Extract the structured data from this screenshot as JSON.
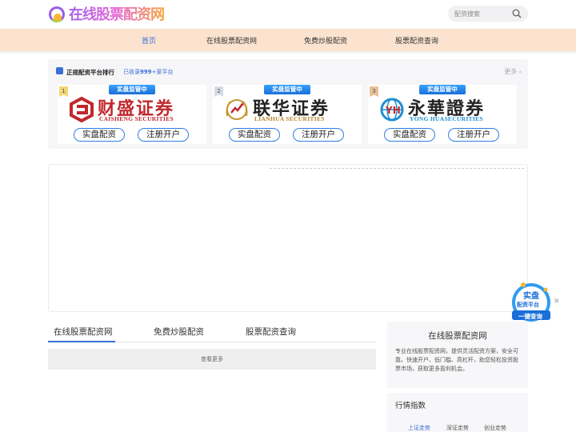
{
  "header": {
    "logo_text": "在线股票配资网",
    "search_placeholder": "配资搜索"
  },
  "nav": {
    "items": [
      {
        "label": "首页",
        "active": true
      },
      {
        "label": "在线股票配资网",
        "active": false
      },
      {
        "label": "免费炒股配资",
        "active": false
      },
      {
        "label": "股票配资查询",
        "active": false
      }
    ]
  },
  "ranking": {
    "title": "正规配资平台排行",
    "subtitle_prefix": "已收录",
    "subtitle_count": "999",
    "subtitle_suffix": "+家平台",
    "more": "更多",
    "cards": [
      {
        "rank": "1",
        "tag": "实盘监管中",
        "name": "财盛证券",
        "en": "CAISHENG SECURITIES",
        "btn1": "实盘配资",
        "btn2": "注册开户",
        "color": "#c0282d"
      },
      {
        "rank": "2",
        "tag": "实盘监管中",
        "name": "联华证券",
        "en": "LIANHUA SECURITIES",
        "btn1": "实盘配资",
        "btn2": "注册开户",
        "color": "#b8862b"
      },
      {
        "rank": "3",
        "tag": "实盘监管中",
        "name": "永華證券",
        "en": "YONG HUASECURITIES",
        "btn1": "实盘配资",
        "btn2": "注册开户",
        "color": "#1e8fd0"
      }
    ]
  },
  "float_ad": {
    "line1": "实盘",
    "line2": "配资平台",
    "line3": "一键查询"
  },
  "tabs": [
    {
      "label": "在线股票配资网"
    },
    {
      "label": "免费炒股配资"
    },
    {
      "label": "股票配资查询"
    }
  ],
  "list_more": "查看更多",
  "sidebar": {
    "title": "在线股票配资网",
    "description": "专业在线股票配资网，提供灵活配资方案，安全可靠。快速开户、低门槛、高杠杆，助您轻松投资股票市场，获取更多盈利机会。",
    "subtitle": "行情指数",
    "links": [
      {
        "label": "上证走势",
        "active": true
      },
      {
        "label": "深证走势",
        "active": false
      },
      {
        "label": "创业走势",
        "active": false
      }
    ]
  }
}
